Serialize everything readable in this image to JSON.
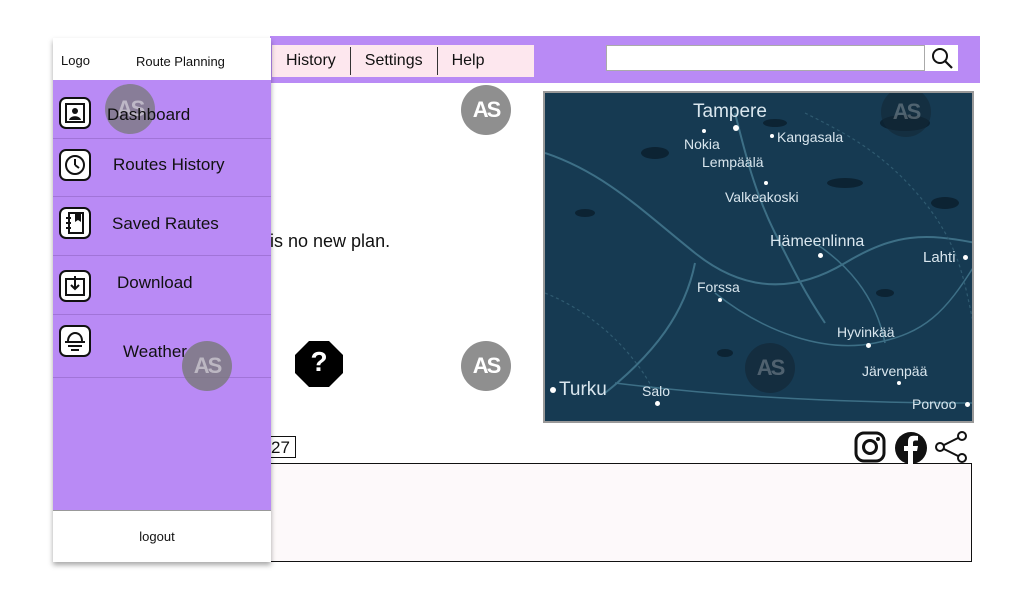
{
  "sidebar": {
    "logo": "Logo",
    "title": "Route Planning",
    "items": [
      {
        "label": "Dashboard",
        "icon": "user-card-icon"
      },
      {
        "label": "Routes History",
        "icon": "clock-icon"
      },
      {
        "label": "Saved Rautes",
        "icon": "notebook-icon"
      },
      {
        "label": "Download",
        "icon": "download-icon"
      },
      {
        "label": "Weather",
        "icon": "weather-icon"
      }
    ],
    "logout": "logout"
  },
  "nav": {
    "items": [
      "History",
      "Settings",
      "Help"
    ],
    "search_placeholder": ""
  },
  "main": {
    "message": "is no new plan.",
    "help_symbol": "?"
  },
  "watermark": "AS",
  "map": {
    "cities": [
      "Tampere",
      "Nokia",
      "Kangasala",
      "Lempäälä",
      "Valkeakoski",
      "Hämeenlinna",
      "Lahti",
      "Forssa",
      "Hyvinkää",
      "Turku",
      "Salo",
      "Järvenpää",
      "Porvoo"
    ]
  },
  "bottom": {
    "counter": "27",
    "social_icons": [
      "instagram-icon",
      "facebook-icon",
      "share-icon"
    ]
  },
  "colors": {
    "accent": "#b98af5",
    "nav_box": "#fde7ee",
    "map_water": "#163a52"
  }
}
